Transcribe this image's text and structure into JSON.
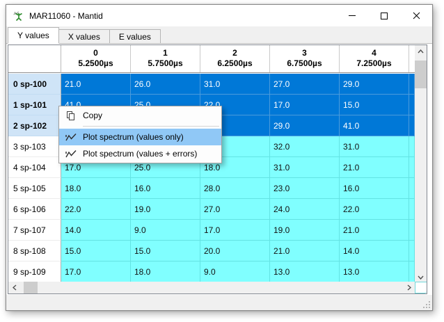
{
  "window": {
    "title": "MAR11060 - Mantid"
  },
  "tabs": [
    {
      "label": "Y values",
      "active": true
    },
    {
      "label": "X values",
      "active": false
    },
    {
      "label": "E values",
      "active": false
    }
  ],
  "table": {
    "columns": [
      {
        "index": "0",
        "time": "5.2500µs"
      },
      {
        "index": "1",
        "time": "5.7500µs"
      },
      {
        "index": "2",
        "time": "6.2500µs"
      },
      {
        "index": "3",
        "time": "6.7500µs"
      },
      {
        "index": "4",
        "time": "7.2500µs"
      }
    ],
    "rows": [
      {
        "header": "0 sp-100",
        "selected": true,
        "values": [
          "21.0",
          "26.0",
          "31.0",
          "27.0",
          "29.0"
        ]
      },
      {
        "header": "1 sp-101",
        "selected": true,
        "values": [
          "41.0",
          "25.0",
          "22.0",
          "17.0",
          "15.0"
        ]
      },
      {
        "header": "2 sp-102",
        "selected": true,
        "values": [
          "",
          "",
          "",
          "29.0",
          "41.0"
        ]
      },
      {
        "header": "3 sp-103",
        "selected": false,
        "values": [
          "",
          "",
          "",
          "32.0",
          "31.0"
        ]
      },
      {
        "header": "4 sp-104",
        "selected": false,
        "values": [
          "17.0",
          "25.0",
          "18.0",
          "31.0",
          "21.0"
        ]
      },
      {
        "header": "5 sp-105",
        "selected": false,
        "values": [
          "18.0",
          "16.0",
          "28.0",
          "23.0",
          "16.0"
        ]
      },
      {
        "header": "6 sp-106",
        "selected": false,
        "values": [
          "22.0",
          "19.0",
          "27.0",
          "24.0",
          "22.0"
        ]
      },
      {
        "header": "7 sp-107",
        "selected": false,
        "values": [
          "14.0",
          "9.0",
          "17.0",
          "19.0",
          "21.0"
        ]
      },
      {
        "header": "8 sp-108",
        "selected": false,
        "values": [
          "15.0",
          "15.0",
          "20.0",
          "21.0",
          "14.0"
        ]
      },
      {
        "header": "9 sp-109",
        "selected": false,
        "values": [
          "17.0",
          "18.0",
          "9.0",
          "13.0",
          "13.0"
        ]
      }
    ]
  },
  "context_menu": {
    "copy": {
      "label": "Copy"
    },
    "plot_values": {
      "label": "Plot spectrum (values only)",
      "highlighted": true
    },
    "plot_errors": {
      "label": "Plot spectrum (values + errors)"
    }
  },
  "colors": {
    "selection_blue": "#0078d7",
    "selection_grid": "#4b9bdc",
    "cell_cyan": "#80ffff",
    "cyan_grid": "#63e3e3",
    "selected_row_header_bg": "#cfe4f7",
    "menu_highlight": "#90c8f6",
    "mantid_green": "#2e8b2e"
  }
}
